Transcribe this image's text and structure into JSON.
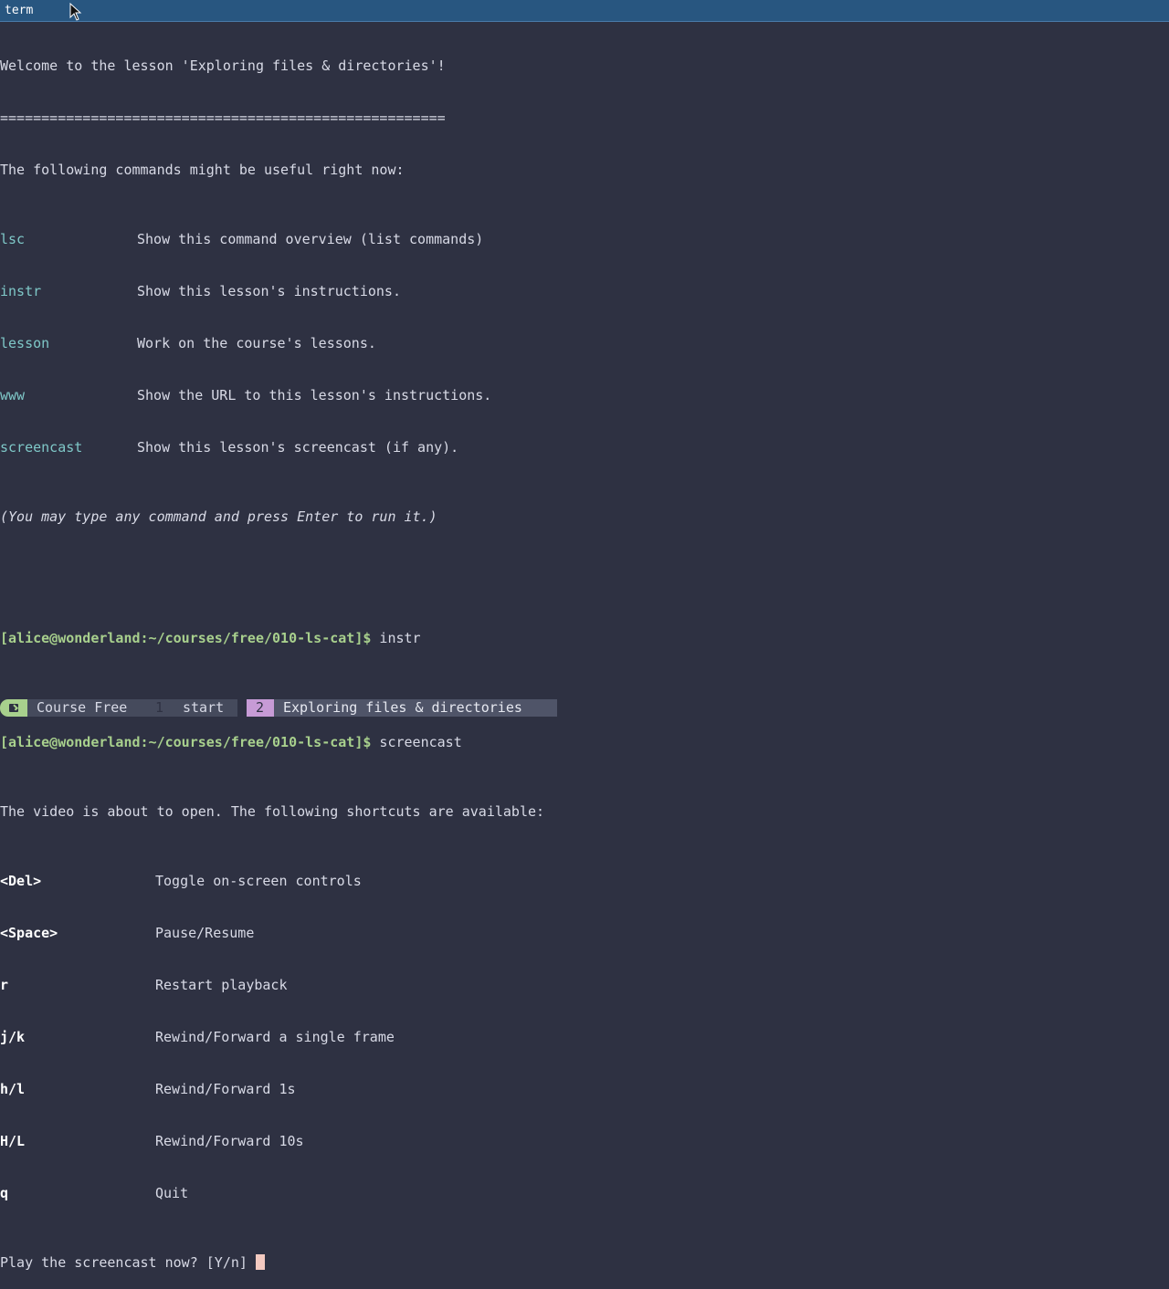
{
  "window": {
    "title": "term"
  },
  "terminal": {
    "welcome": "Welcome to the lesson 'Exploring files & directories'!",
    "separator": "======================================================",
    "intro": "The following commands might be useful right now:",
    "commands": [
      {
        "cmd": "lsc",
        "desc": "Show this command overview (list commands)"
      },
      {
        "cmd": "instr",
        "desc": "Show this lesson's instructions."
      },
      {
        "cmd": "lesson",
        "desc": "Work on the course's lessons."
      },
      {
        "cmd": "www",
        "desc": "Show the URL to this lesson's instructions."
      },
      {
        "cmd": "screencast",
        "desc": "Show this lesson's screencast (if any)."
      }
    ],
    "hint": "(You may type any command and press Enter to run it.)",
    "prompt": "[alice@wonderland:~/courses/free/010-ls-cat]$",
    "entered_1": " instr",
    "entered_2": " screencast",
    "video_msg": "The video is about to open. The following shortcuts are available:",
    "shortcuts": [
      {
        "key": "<Del>",
        "desc": "Toggle on-screen controls"
      },
      {
        "key": "<Space>",
        "desc": "Pause/Resume"
      },
      {
        "key": "r",
        "desc": "Restart playback"
      },
      {
        "key": "j/k",
        "desc": "Rewind/Forward a single frame"
      },
      {
        "key": "h/l",
        "desc": "Rewind/Forward 1s"
      },
      {
        "key": "H/L",
        "desc": "Rewind/Forward 10s"
      },
      {
        "key": "q",
        "desc": "Quit"
      }
    ],
    "question": "Play the screencast now? [Y/n] "
  },
  "statusbar": {
    "session": "Course Free",
    "windows": [
      {
        "index": "1",
        "name": "start"
      },
      {
        "index": "2",
        "name": "Exploring files & directories"
      }
    ]
  },
  "colors": {
    "background": "#2e3142",
    "titlebar": "#285680",
    "prompt": "#a8d08d",
    "command": "#7fc8c8",
    "active_window_index": "#c79bd6",
    "cursor": "#f3c9c0"
  }
}
